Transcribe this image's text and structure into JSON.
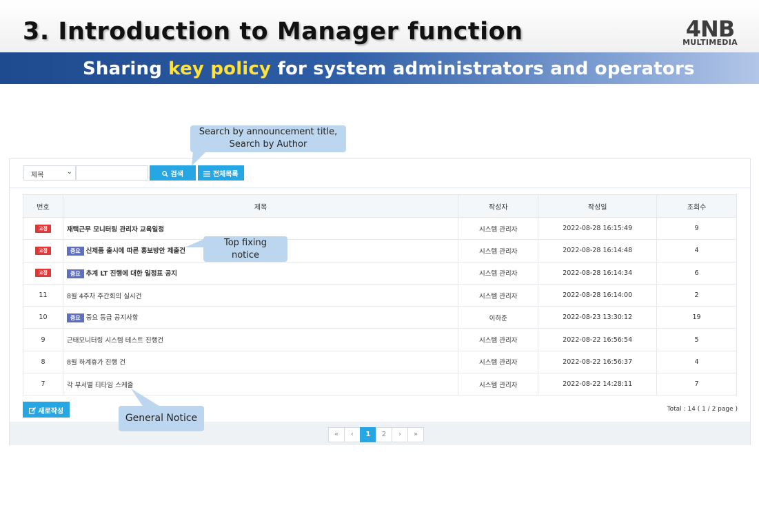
{
  "slide": {
    "title": "3. Introduction to Manager function",
    "logo_main": "4NB",
    "logo_sub": "MULTIMEDIA",
    "banner_before": "Sharing ",
    "banner_highlight": "key policy",
    "banner_after": " for system administrators and operators",
    "highlight_color": "#ffe23b"
  },
  "search": {
    "select_value": "제목",
    "search_button": "검색",
    "list_button": "전체목록",
    "search_icon": "magnifier-icon",
    "list_icon": "list-icon"
  },
  "table": {
    "headers": [
      "번호",
      "제목",
      "작성자",
      "작성일",
      "조회수"
    ],
    "rows": [
      {
        "no_badge": "고정",
        "important": "",
        "title": "재택근무 모니터링 관리자 교육일정",
        "author": "시스템 관리자",
        "date": "2022-08-28 16:15:49",
        "views": "9"
      },
      {
        "no_badge": "고정",
        "important": "중요",
        "title": "신제품 출시에 따른 홍보방안 제출건",
        "author": "시스템 관리자",
        "date": "2022-08-28 16:14:48",
        "views": "4"
      },
      {
        "no_badge": "고정",
        "important": "중요",
        "title": "추계 LT 진행에 대한 일정표 공지",
        "author": "시스템 관리자",
        "date": "2022-08-28 16:14:34",
        "views": "6"
      },
      {
        "no": "11",
        "important": "",
        "title": "8월 4주차 주간회의 실시건",
        "author": "시스템 관리자",
        "date": "2022-08-28 16:14:00",
        "views": "2"
      },
      {
        "no": "10",
        "important": "중요",
        "title": "중요 등급 공지사항",
        "author": "이하준",
        "date": "2022-08-23 13:30:12",
        "views": "19"
      },
      {
        "no": "9",
        "important": "",
        "title": "근태모니터링 시스템 테스트 진행건",
        "author": "시스템 관리자",
        "date": "2022-08-22 16:56:54",
        "views": "5"
      },
      {
        "no": "8",
        "important": "",
        "title": "8월 하계휴가 진행 건",
        "author": "시스템 관리자",
        "date": "2022-08-22 16:56:37",
        "views": "4"
      },
      {
        "no": "7",
        "important": "",
        "title": "각 부서별 티타임 스케줄",
        "author": "시스템 관리자",
        "date": "2022-08-22 14:28:11",
        "views": "7"
      }
    ]
  },
  "footer": {
    "write_button": "새로작성",
    "write_icon": "edit-icon",
    "total_text": "Total : 14 ( 1 / 2 page )"
  },
  "pagination": {
    "first": "«",
    "prev": "‹",
    "pages": [
      "1",
      "2"
    ],
    "current": "1",
    "next": "›",
    "last": "»"
  },
  "callouts": {
    "search_line1": "Search by announcement title,",
    "search_line2": "Search by Author",
    "top_line1": "Top fixing",
    "top_line2": "notice",
    "general": "General Notice"
  },
  "colors": {
    "accent": "#26a6e3",
    "fixed_badge": "#e53535",
    "important_badge": "#5e6fc0",
    "callout": "#bcd6ef"
  }
}
